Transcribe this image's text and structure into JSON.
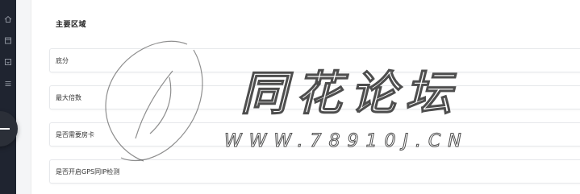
{
  "section": {
    "title": "主要区域"
  },
  "rows": [
    {
      "label": "底分"
    },
    {
      "label": "最大倍数"
    },
    {
      "label": "是否需要房卡"
    },
    {
      "label": "是否开启GPS同IP检测"
    }
  ],
  "watermark": {
    "title": "同花论坛",
    "url": "WWW.78910J.CN"
  },
  "icons": {
    "rail": [
      "home-icon",
      "calendar-icon",
      "box-icon",
      "list-icon"
    ],
    "fab": "collapse-icon",
    "row": "chevron-down-icon"
  },
  "colors": {
    "rail": "#1f2430",
    "background": "#f4f5f7",
    "card": "#ffffff",
    "border": "#e6e8eb"
  }
}
